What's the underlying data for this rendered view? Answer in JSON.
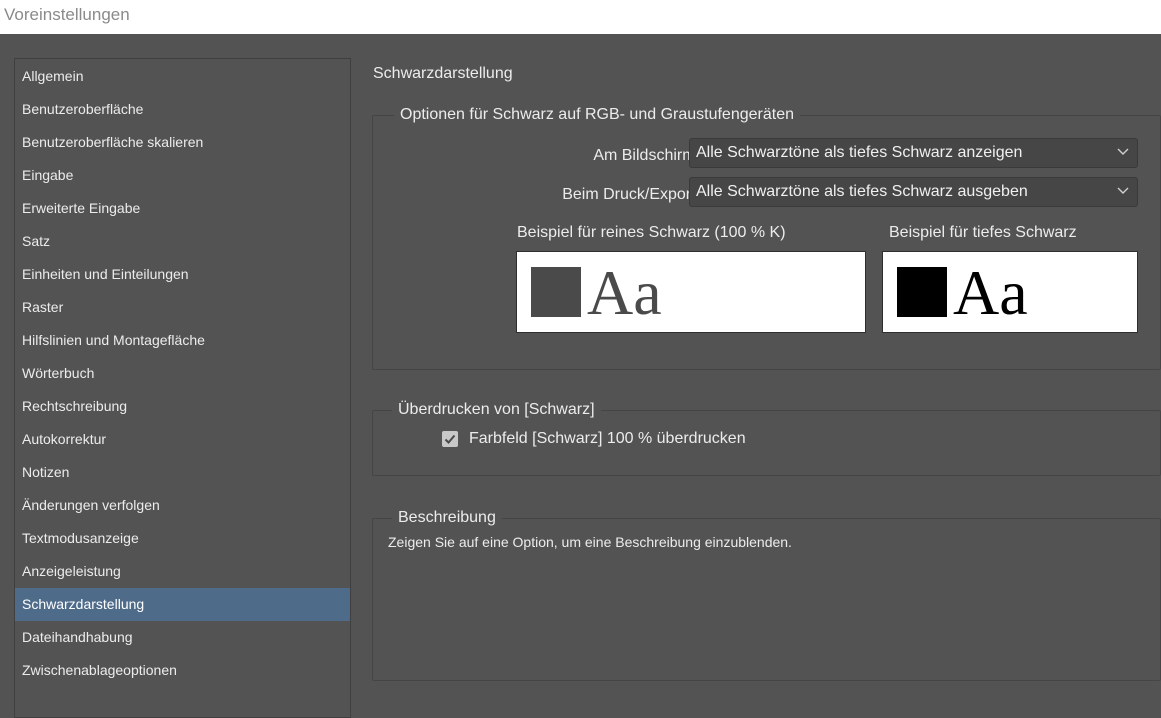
{
  "window": {
    "title": "Voreinstellungen"
  },
  "sidebar": {
    "items": [
      {
        "label": "Allgemein"
      },
      {
        "label": "Benutzeroberfläche"
      },
      {
        "label": "Benutzeroberfläche skalieren"
      },
      {
        "label": "Eingabe"
      },
      {
        "label": "Erweiterte Eingabe"
      },
      {
        "label": "Satz"
      },
      {
        "label": "Einheiten und Einteilungen"
      },
      {
        "label": "Raster"
      },
      {
        "label": "Hilfslinien und Montagefläche"
      },
      {
        "label": "Wörterbuch"
      },
      {
        "label": "Rechtschreibung"
      },
      {
        "label": "Autokorrektur"
      },
      {
        "label": "Notizen"
      },
      {
        "label": "Änderungen verfolgen"
      },
      {
        "label": "Textmodusanzeige"
      },
      {
        "label": "Anzeigeleistung"
      },
      {
        "label": "Schwarzdarstellung"
      },
      {
        "label": "Dateihandhabung"
      },
      {
        "label": "Zwischenablageoptionen"
      }
    ],
    "selected": "Schwarzdarstellung"
  },
  "main": {
    "title": "Schwarzdarstellung",
    "options_group": {
      "legend": "Optionen für Schwarz auf RGB- und Graustufengeräten",
      "screen_label": "Am Bildschirm:",
      "screen_value": "Alle Schwarztöne als tiefes Schwarz anzeigen",
      "print_label": "Beim Druck/Export:",
      "print_value": "Alle Schwarztöne als tiefes Schwarz ausgeben",
      "sample_pure_label": "Beispiel für reines Schwarz (100 % K)",
      "sample_rich_label": "Beispiel für tiefes Schwarz",
      "sample_text": "Aa",
      "pure_black_color": "#4a4a4a",
      "rich_black_color": "#000000"
    },
    "overprint_group": {
      "legend": "Überdrucken von [Schwarz]",
      "checkbox_label": "Farbfeld [Schwarz] 100 % überdrucken",
      "checked": true
    },
    "description_group": {
      "legend": "Beschreibung",
      "text": "Zeigen Sie auf eine Option, um eine Beschreibung einzublenden."
    }
  },
  "icons": {
    "dropdown": "chevron-down-icon",
    "checkbox": "checkmark-icon"
  }
}
